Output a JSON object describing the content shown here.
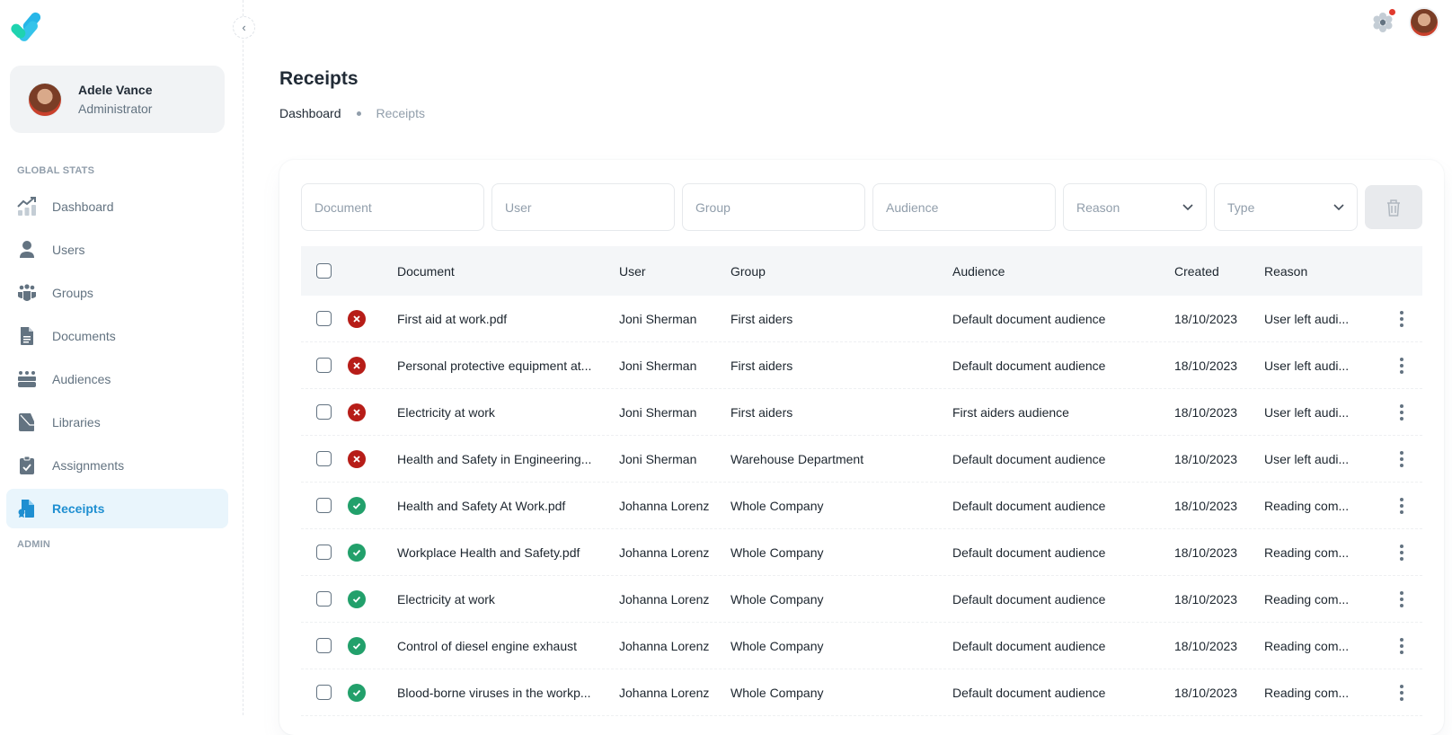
{
  "colors": {
    "accent": "#1f8fd1",
    "success": "#22a06b",
    "error": "#b71d18",
    "notification": "#e03a2e"
  },
  "sidebar": {
    "user": {
      "name": "Adele Vance",
      "role": "Administrator"
    },
    "section_global": "GLOBAL STATS",
    "section_admin": "ADMIN",
    "items": [
      {
        "label": "Dashboard",
        "icon": "chart-trend-icon"
      },
      {
        "label": "Users",
        "icon": "user-icon"
      },
      {
        "label": "Groups",
        "icon": "groups-icon"
      },
      {
        "label": "Documents",
        "icon": "document-icon"
      },
      {
        "label": "Audiences",
        "icon": "audience-icon"
      },
      {
        "label": "Libraries",
        "icon": "library-icon"
      },
      {
        "label": "Assignments",
        "icon": "clipboard-check-icon"
      },
      {
        "label": "Receipts",
        "icon": "receipt-icon",
        "active": true
      }
    ]
  },
  "header": {
    "title": "Receipts",
    "breadcrumb": [
      "Dashboard",
      "Receipts"
    ]
  },
  "filters": {
    "document_placeholder": "Document",
    "user_placeholder": "User",
    "group_placeholder": "Group",
    "audience_placeholder": "Audience",
    "reason_placeholder": "Reason",
    "type_placeholder": "Type"
  },
  "table": {
    "columns": [
      "Document",
      "User",
      "Group",
      "Audience",
      "Created",
      "Reason"
    ],
    "rows": [
      {
        "status": "fail",
        "document": "First aid at work.pdf",
        "user": "Joni Sherman",
        "group": "First aiders",
        "audience": "Default document audience",
        "created": "18/10/2023",
        "reason": "User left audi..."
      },
      {
        "status": "fail",
        "document": "Personal protective equipment at...",
        "user": "Joni Sherman",
        "group": "First aiders",
        "audience": "Default document audience",
        "created": "18/10/2023",
        "reason": "User left audi..."
      },
      {
        "status": "fail",
        "document": "Electricity at work",
        "user": "Joni Sherman",
        "group": "First aiders",
        "audience": "First aiders audience",
        "created": "18/10/2023",
        "reason": "User left audi..."
      },
      {
        "status": "fail",
        "document": "Health and Safety in Engineering...",
        "user": "Joni Sherman",
        "group": "Warehouse Department",
        "audience": "Default document audience",
        "created": "18/10/2023",
        "reason": "User left audi..."
      },
      {
        "status": "ok",
        "document": "Health and Safety At Work.pdf",
        "user": "Johanna Lorenz",
        "group": "Whole Company",
        "audience": "Default document audience",
        "created": "18/10/2023",
        "reason": "Reading com..."
      },
      {
        "status": "ok",
        "document": "Workplace Health and Safety.pdf",
        "user": "Johanna Lorenz",
        "group": "Whole Company",
        "audience": "Default document audience",
        "created": "18/10/2023",
        "reason": "Reading com..."
      },
      {
        "status": "ok",
        "document": "Electricity at work",
        "user": "Johanna Lorenz",
        "group": "Whole Company",
        "audience": "Default document audience",
        "created": "18/10/2023",
        "reason": "Reading com..."
      },
      {
        "status": "ok",
        "document": "Control of diesel engine exhaust",
        "user": "Johanna Lorenz",
        "group": "Whole Company",
        "audience": "Default document audience",
        "created": "18/10/2023",
        "reason": "Reading com..."
      },
      {
        "status": "ok",
        "document": "Blood-borne viruses in the workp...",
        "user": "Johanna Lorenz",
        "group": "Whole Company",
        "audience": "Default document audience",
        "created": "18/10/2023",
        "reason": "Reading com..."
      }
    ]
  }
}
